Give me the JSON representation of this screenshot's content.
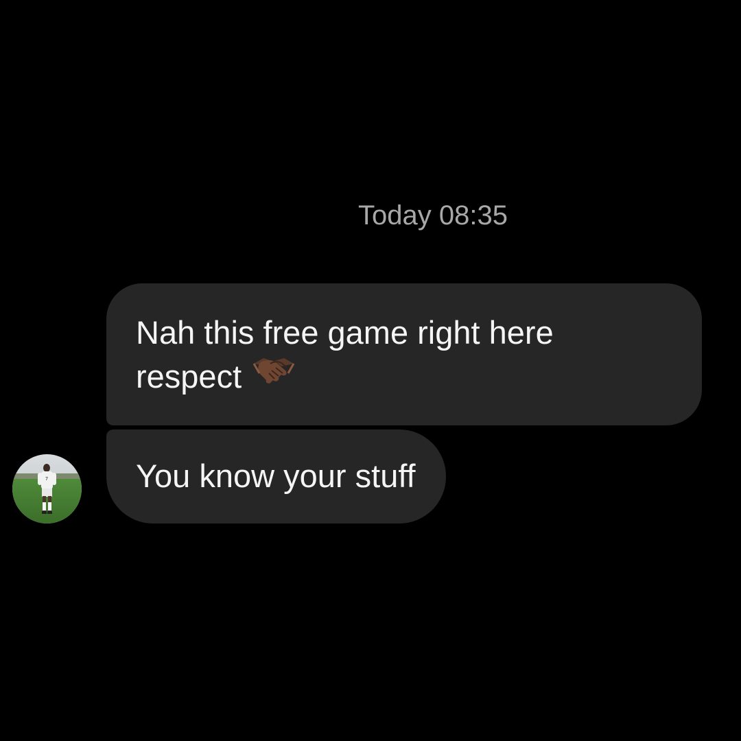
{
  "conversation": {
    "timestamp": "Today 08:35",
    "messages": [
      {
        "text_line1": "Nah this free game right here",
        "text_line2": "respect",
        "emoji": "handshake-icon"
      },
      {
        "text": "You know your stuff"
      }
    ]
  },
  "colors": {
    "background": "#000000",
    "bubble": "#262626",
    "message_text": "#f5f5f5",
    "timestamp_text": "#a8a8a8"
  }
}
